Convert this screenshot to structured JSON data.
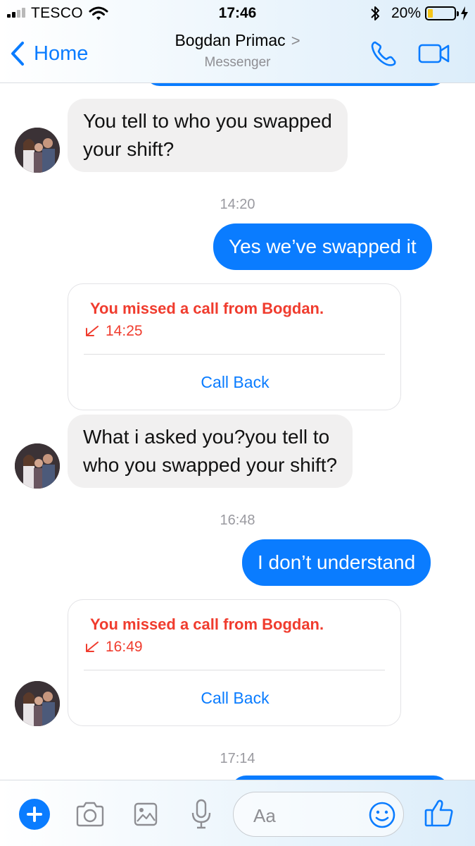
{
  "status_bar": {
    "carrier": "TESCO",
    "time": "17:46",
    "battery_percent": "20%",
    "battery_level": 0.2
  },
  "nav": {
    "back_label": "Home",
    "contact_name": "Bogdan Primac",
    "subtitle": "Messenger",
    "chevron": ">"
  },
  "messages": [
    {
      "type": "incoming",
      "text_lines": [
        "You tell to who you swapped",
        "your shift?"
      ]
    },
    {
      "type": "timestamp",
      "text": "14:20"
    },
    {
      "type": "outgoing",
      "text": "Yes we’ve swapped it"
    },
    {
      "type": "missed_call",
      "text": "You missed a call from Bogdan.",
      "time": "14:25",
      "action": "Call Back"
    },
    {
      "type": "incoming",
      "text_lines": [
        "What i asked you?you tell to",
        "who you swapped your shift?"
      ]
    },
    {
      "type": "timestamp",
      "text": "16:48"
    },
    {
      "type": "outgoing",
      "text": "I don’t understand"
    },
    {
      "type": "missed_call",
      "text": "You missed a call from Bogdan.",
      "time": "16:49",
      "action": "Call Back"
    },
    {
      "type": "timestamp",
      "text": "17:14"
    }
  ],
  "composer": {
    "placeholder": "Aa",
    "icons": [
      "plus-icon",
      "camera-icon",
      "photo-icon",
      "microphone-icon",
      "emoji-icon",
      "thumbs-up-icon"
    ]
  },
  "colors": {
    "accent": "#0a7cff",
    "missed_call": "#f03c2e",
    "incoming_bubble": "#f1f0f0",
    "timestamp": "#9a9aa0"
  }
}
